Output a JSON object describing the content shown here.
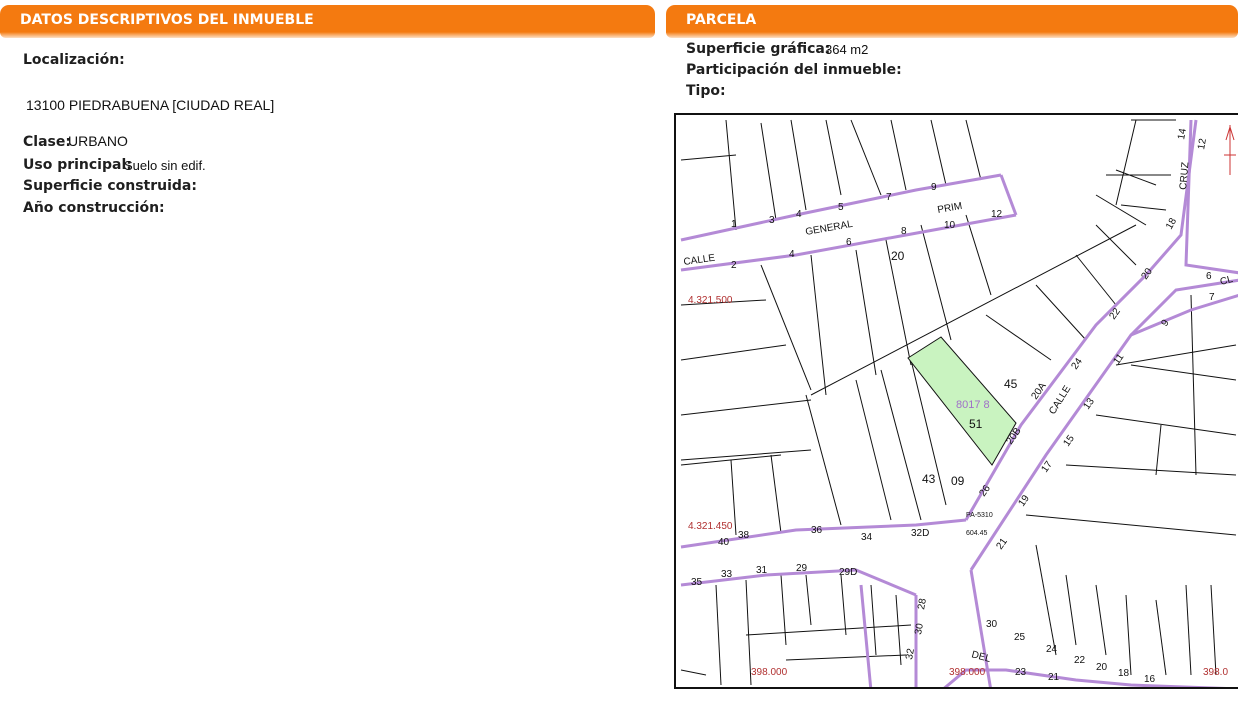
{
  "left_panel": {
    "title": "DATOS DESCRIPTIVOS DEL INMUEBLE",
    "localizacion_label": "Localización:",
    "localizacion_value": "13100 PIEDRABUENA [CIUDAD REAL]",
    "clase_label": "Clase:",
    "clase_value": "URBANO",
    "uso_label": "Uso principal:",
    "uso_value": "Suelo sin edif.",
    "superficie_construida_label": "Superficie construida:",
    "anio_label": "Año construcción:"
  },
  "right_panel": {
    "title": "PARCELA",
    "superficie_grafica_label": "Superficie gráfica:",
    "superficie_grafica_value": "364 m2",
    "participacion_label": "Participación del inmueble:",
    "tipo_label": "Tipo:"
  },
  "map": {
    "parcel_fill": "#c9f3c0",
    "boundary_color": "#b48ad6",
    "parcel_id": "8017 8",
    "parcel_number": "51",
    "coords": [
      "4.321.500",
      "4.321.450",
      "398.000",
      "398.000",
      "398.0"
    ],
    "street_labels": [
      "CALLE",
      "GENERAL",
      "PRIM",
      "CALLE",
      "CRUZ",
      "DEL",
      "CL"
    ],
    "house_numbers": [
      "1",
      "3",
      "4",
      "5",
      "7",
      "9",
      "2",
      "4",
      "6",
      "8",
      "10",
      "12",
      "20",
      "45",
      "43",
      "09",
      "40",
      "38",
      "36",
      "34",
      "32D",
      "35",
      "33",
      "31",
      "29",
      "29D",
      "28",
      "30",
      "32",
      "30",
      "25",
      "24",
      "22",
      "20",
      "18",
      "16",
      "23",
      "21",
      "14",
      "12",
      "16",
      "18",
      "20",
      "22",
      "24",
      "20A",
      "20B",
      "26",
      "21",
      "19",
      "17",
      "15",
      "13",
      "11",
      "9",
      "7",
      "6"
    ],
    "misc_labels": [
      "PA-5310",
      "604.45"
    ]
  }
}
